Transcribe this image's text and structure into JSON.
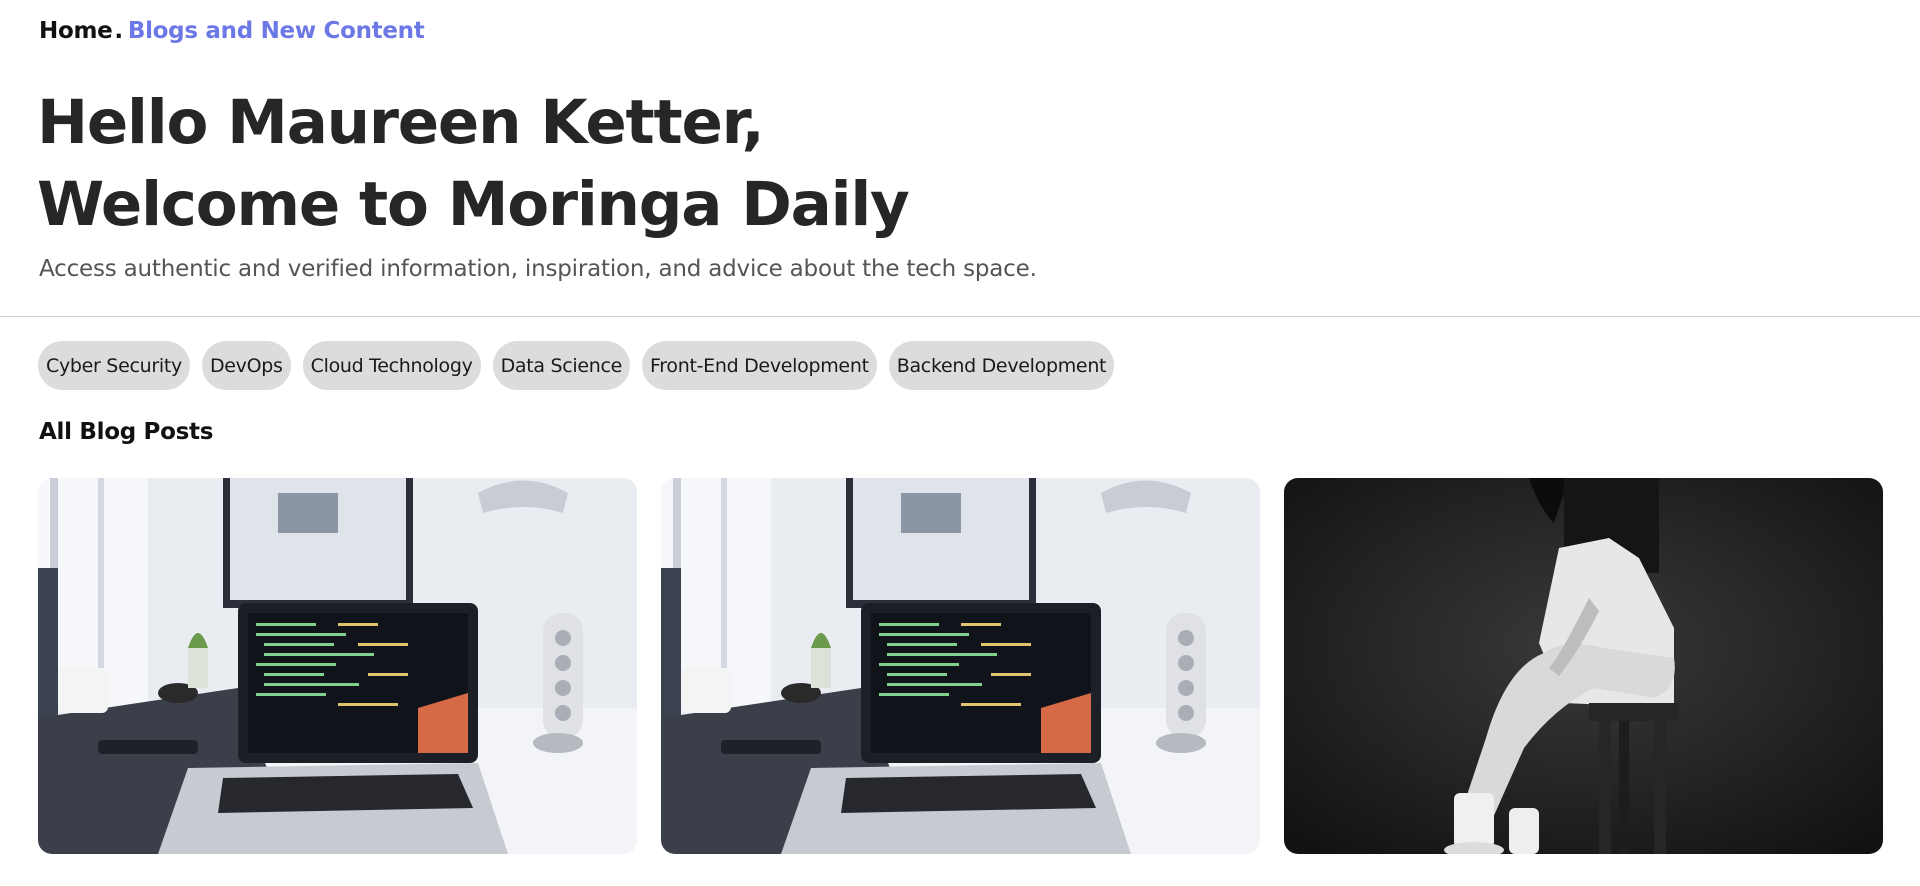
{
  "breadcrumb": {
    "home": "Home",
    "separator": ".",
    "current": "Blogs and New Content"
  },
  "hero": {
    "greeting": "Hello Maureen Ketter,",
    "welcome": "Welcome to Moringa Daily",
    "subtitle": "Access authentic and verified information, inspiration, and advice about the tech space."
  },
  "categories": [
    "Cyber Security",
    "DevOps",
    "Cloud Technology",
    "Data Science",
    "Front-End Development",
    "Backend Development"
  ],
  "posts_section": {
    "title": "All Blog Posts"
  },
  "posts": [
    {
      "image": "laptop-desk-photo"
    },
    {
      "image": "laptop-desk-photo"
    },
    {
      "image": "person-sitting-stool-bw-photo"
    }
  ],
  "colors": {
    "accent": "#6c78e6",
    "chip_bg": "#dcdcdc",
    "heading": "#262626"
  }
}
